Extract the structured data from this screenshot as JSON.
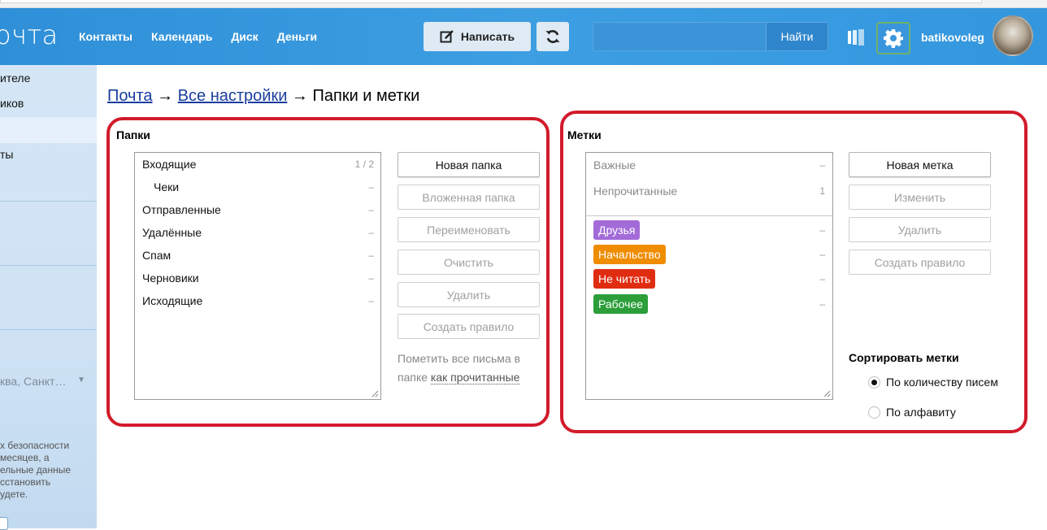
{
  "header": {
    "logo_text": "очта",
    "nav": [
      "Контакты",
      "Календарь",
      "Диск",
      "Деньги"
    ],
    "compose_label": "Написать",
    "search_placeholder": "",
    "find_label": "Найти",
    "username": "batikovoleg"
  },
  "sidebar": {
    "items": [
      "ителе",
      "иков",
      "ты"
    ],
    "location": "ква, Санкт…",
    "security_text": [
      "х безопасности",
      " месяцев, а",
      "ельные данные",
      "сстановить",
      "удете."
    ]
  },
  "breadcrumb": {
    "mail": "Почта",
    "arrow1": " → ",
    "all_settings": "Все настройки",
    "arrow2": " → ",
    "current": "Папки и метки"
  },
  "folders": {
    "title": "Папки",
    "items": [
      {
        "name": "Входящие",
        "count": "1 / 2"
      },
      {
        "name": "Чеки",
        "count": "–"
      },
      {
        "name": "Отправленные",
        "count": "–"
      },
      {
        "name": "Удалённые",
        "count": "–"
      },
      {
        "name": "Спам",
        "count": "–"
      },
      {
        "name": "Черновики",
        "count": "–"
      },
      {
        "name": "Исходящие",
        "count": "–"
      }
    ],
    "buttons": {
      "new": "Новая папка",
      "nested": "Вложенная папка",
      "rename": "Переименовать",
      "clear": "Очистить",
      "delete": "Удалить",
      "rule": "Создать правило"
    },
    "hint_prefix": "Пометить все письма в",
    "hint_mid": "папке ",
    "hint_link": "как прочитанные"
  },
  "labels": {
    "title": "Метки",
    "system": [
      {
        "name": "Важные",
        "count": "–"
      },
      {
        "name": "Непрочитанные",
        "count": "1"
      }
    ],
    "user": [
      {
        "name": "Друзья",
        "count": "–",
        "color": "#a36bd8"
      },
      {
        "name": "Начальство",
        "count": "–",
        "color": "#f08c00"
      },
      {
        "name": "Не читать",
        "count": "–",
        "color": "#e02d12"
      },
      {
        "name": "Рабочее",
        "count": "–",
        "color": "#2b9e3a"
      }
    ],
    "buttons": {
      "new": "Новая метка",
      "edit": "Изменить",
      "delete": "Удалить",
      "rule": "Создать правило"
    },
    "sort_title": "Сортировать метки",
    "sort_options": [
      "По количеству писем",
      "По алфавиту"
    ],
    "sort_selected": "По количеству писем"
  },
  "colors": {
    "header_blue": "#3497de",
    "highlight_red": "#d21b2b"
  }
}
